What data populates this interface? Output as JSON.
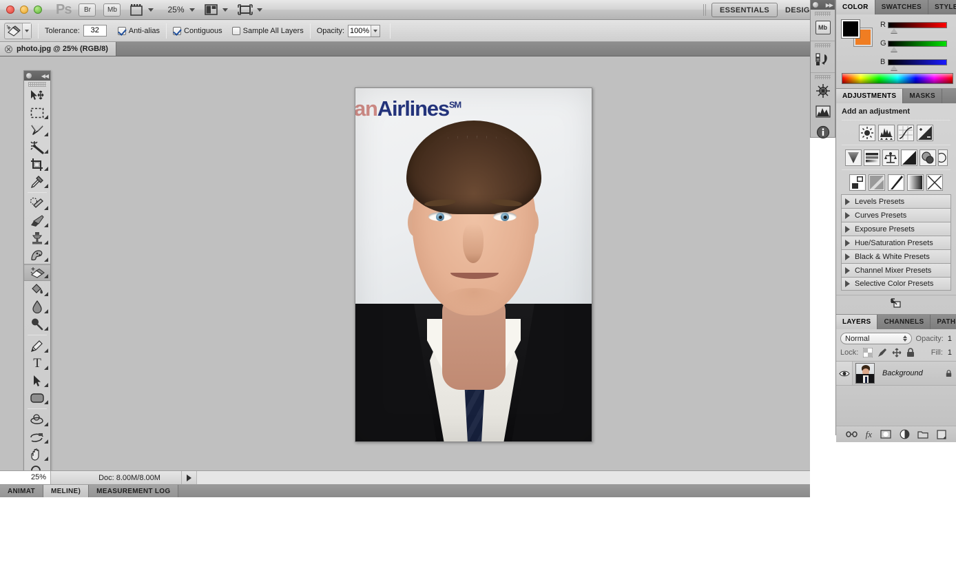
{
  "app": {
    "title": "Adobe Photoshop",
    "logo_text": "Ps",
    "bridge_label": "Br",
    "minibridge_label": "Mb",
    "zoom_level": "25%",
    "view_extras_icon": "view-extras-icon",
    "arrange_documents_icon": "arrange-documents-icon",
    "screen_mode_icon": "screen-mode-icon",
    "workspaces": [
      {
        "label": "ESSENTIALS",
        "active": true
      },
      {
        "label": "DESIGN",
        "active": false
      }
    ]
  },
  "options_bar": {
    "tool_icon": "magic-eraser-tool-icon",
    "tolerance_label": "Tolerance:",
    "tolerance_value": "32",
    "antialias_label": "Anti-alias",
    "antialias_checked": true,
    "contiguous_label": "Contiguous",
    "contiguous_checked": true,
    "sample_all_layers_label": "Sample All Layers",
    "sample_all_layers_checked": false,
    "opacity_label": "Opacity:",
    "opacity_value": "100%"
  },
  "document_tab": {
    "title": "photo.jpg @ 25% (RGB/8)",
    "close_icon": "close-icon"
  },
  "canvas": {
    "background_color": "#c0c0c0",
    "photo": {
      "backdrop_text_a": "an",
      "backdrop_text_b": "Airlines",
      "backdrop_text_sm": "SM",
      "description": "Portrait of a man in a black suit, white shirt and dark navy tie in front of a step-and-repeat airline banner"
    }
  },
  "tools_panel": {
    "collapse_icon": "collapse-icon",
    "items": [
      {
        "name": "move-tool",
        "icon": "move-tool-icon",
        "selected": false,
        "has_flyout": false
      },
      {
        "name": "marquee-tool",
        "icon": "rectangular-marquee-icon",
        "selected": false,
        "has_flyout": true
      },
      {
        "name": "lasso-tool",
        "icon": "lasso-tool-icon",
        "selected": false,
        "has_flyout": true
      },
      {
        "name": "magic-wand-tool",
        "icon": "magic-wand-icon",
        "selected": false,
        "has_flyout": true
      },
      {
        "name": "crop-tool",
        "icon": "crop-tool-icon",
        "selected": false,
        "has_flyout": true
      },
      {
        "name": "eyedropper-tool",
        "icon": "eyedropper-icon",
        "selected": false,
        "has_flyout": true
      },
      {
        "name": "spot-healing-tool",
        "icon": "spot-healing-brush-icon",
        "selected": false,
        "has_flyout": true
      },
      {
        "name": "brush-tool",
        "icon": "brush-tool-icon",
        "selected": false,
        "has_flyout": true
      },
      {
        "name": "clone-stamp-tool",
        "icon": "clone-stamp-icon",
        "selected": false,
        "has_flyout": true
      },
      {
        "name": "history-brush-tool",
        "icon": "history-brush-icon",
        "selected": false,
        "has_flyout": true
      },
      {
        "name": "eraser-tool",
        "icon": "magic-eraser-icon",
        "selected": true,
        "has_flyout": true
      },
      {
        "name": "gradient-tool",
        "icon": "paint-bucket-icon",
        "selected": false,
        "has_flyout": true
      },
      {
        "name": "blur-tool",
        "icon": "blur-tool-icon",
        "selected": false,
        "has_flyout": true
      },
      {
        "name": "dodge-tool",
        "icon": "dodge-tool-icon",
        "selected": false,
        "has_flyout": true
      },
      {
        "name": "pen-tool",
        "icon": "pen-tool-icon",
        "selected": false,
        "has_flyout": true
      },
      {
        "name": "type-tool",
        "icon": "type-tool-icon",
        "selected": false,
        "has_flyout": true
      },
      {
        "name": "path-selection-tool",
        "icon": "path-selection-icon",
        "selected": false,
        "has_flyout": true
      },
      {
        "name": "shape-tool",
        "icon": "rounded-rectangle-icon",
        "selected": false,
        "has_flyout": true
      },
      {
        "name": "rotate-3d-tool",
        "icon": "3d-object-rotate-icon",
        "selected": false,
        "has_flyout": true
      },
      {
        "name": "3d-camera-tool",
        "icon": "3d-camera-orbit-icon",
        "selected": false,
        "has_flyout": true
      },
      {
        "name": "hand-tool",
        "icon": "hand-tool-icon",
        "selected": false,
        "has_flyout": true
      },
      {
        "name": "zoom-tool",
        "icon": "zoom-tool-icon",
        "selected": false,
        "has_flyout": false
      }
    ],
    "default_colors_icon": "default-colors-icon",
    "swap_colors_icon": "swap-colors-icon",
    "foreground_color": "#000000",
    "background_color": "#f07d22",
    "quick_mask_icon": "quick-mask-icon"
  },
  "status_bar": {
    "zoom": "25%",
    "doc_info": "Doc: 8.00M/8.00M",
    "expand_icon": "expand-arrow-icon"
  },
  "bottom_tabs": [
    {
      "label": "ANIMAT",
      "active": false
    },
    {
      "label": "MELINE)",
      "active": true
    },
    {
      "label": "MEASUREMENT LOG",
      "active": false
    }
  ],
  "dock": {
    "items": [
      {
        "name": "mini-bridge",
        "label": "Mb",
        "icon": "mini-bridge-icon"
      },
      {
        "name": "history",
        "label": "",
        "icon": "history-panel-icon"
      },
      {
        "name": "kuler",
        "label": "",
        "icon": "kuler-wheel-icon"
      },
      {
        "name": "histogram",
        "label": "",
        "icon": "histogram-icon"
      },
      {
        "name": "info",
        "label": "",
        "icon": "info-icon"
      }
    ]
  },
  "color_panel": {
    "tabs": [
      {
        "label": "COLOR",
        "active": true
      },
      {
        "label": "SWATCHES",
        "active": false
      },
      {
        "label": "STYLES",
        "active": false
      }
    ],
    "foreground_color": "#000000",
    "background_color": "#f07d22",
    "sliders": [
      {
        "label": "R",
        "value": "3"
      },
      {
        "label": "G",
        "value": "3"
      },
      {
        "label": "B",
        "value": "3"
      }
    ],
    "spectrum_icon": "color-ramp"
  },
  "adjustments_panel": {
    "tabs": [
      {
        "label": "ADJUSTMENTS",
        "active": true
      },
      {
        "label": "MASKS",
        "active": false
      }
    ],
    "heading": "Add an adjustment",
    "buttons_row1": [
      "brightness-contrast-icon",
      "levels-icon",
      "curves-icon",
      "exposure-icon"
    ],
    "buttons_row2": [
      "vibrance-icon",
      "hue-saturation-icon",
      "color-balance-icon",
      "black-white-icon",
      "photo-filter-icon",
      "channel-mixer-icon"
    ],
    "buttons_row3": [
      "invert-icon",
      "posterize-icon",
      "threshold-icon",
      "gradient-map-icon",
      "selective-color-icon"
    ],
    "presets": [
      "Levels Presets",
      "Curves Presets",
      "Exposure Presets",
      "Hue/Saturation Presets",
      "Black & White Presets",
      "Channel Mixer Presets",
      "Selective Color Presets"
    ],
    "footer_icon": "return-to-adjustment-list-icon"
  },
  "layers_panel": {
    "tabs": [
      {
        "label": "LAYERS",
        "active": true
      },
      {
        "label": "CHANNELS",
        "active": false
      },
      {
        "label": "PATHS",
        "active": false
      }
    ],
    "blend_mode": "Normal",
    "opacity_label": "Opacity:",
    "opacity_value": "1",
    "lock_label": "Lock:",
    "lock_icons": [
      "lock-transparency-icon",
      "lock-image-icon",
      "lock-position-icon",
      "lock-all-icon"
    ],
    "fill_label": "Fill:",
    "fill_value": "1",
    "layers": [
      {
        "name": "Background",
        "visible": true,
        "locked": true,
        "thumbnail": "portrait-thumbnail"
      }
    ],
    "footer_icons": [
      "link-layers-icon",
      "layer-style-fx-icon",
      "add-layer-mask-icon",
      "new-fill-adjustment-icon",
      "new-group-icon",
      "new-layer-icon"
    ]
  }
}
